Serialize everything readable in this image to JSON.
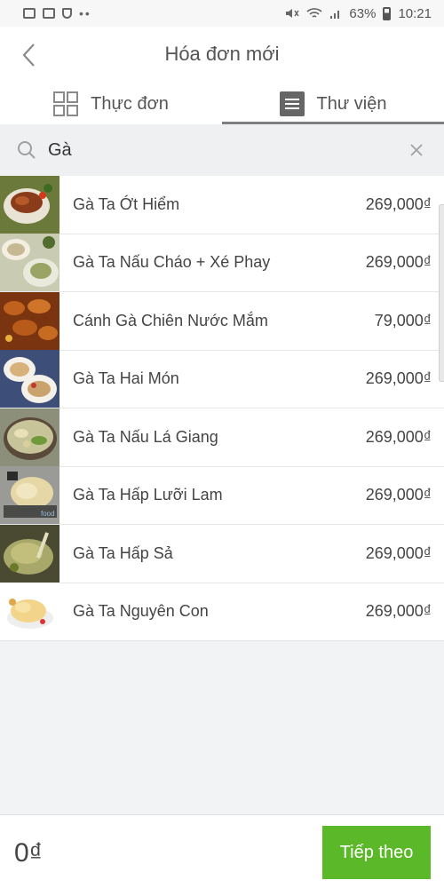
{
  "status_bar": {
    "battery": "63%",
    "time": "10:21"
  },
  "header": {
    "title": "Hóa đơn mới"
  },
  "tabs": [
    {
      "label": "Thực đơn",
      "icon": "grid-icon"
    },
    {
      "label": "Thư viện",
      "icon": "list-icon",
      "active": true
    }
  ],
  "search": {
    "value": "Gà"
  },
  "items": [
    {
      "name": "Gà Ta Ớt Hiểm",
      "price": "269,000₫"
    },
    {
      "name": "Gà Ta Nấu Cháo + Xé Phay",
      "price": "269,000₫"
    },
    {
      "name": "Cánh Gà Chiên Nước Mắm",
      "price": "79,000₫"
    },
    {
      "name": "Gà Ta Hai Món",
      "price": "269,000₫"
    },
    {
      "name": "Gà Ta Nấu Lá Giang",
      "price": "269,000₫"
    },
    {
      "name": "Gà Ta Hấp Lưỡi Lam",
      "price": "269,000₫"
    },
    {
      "name": "Gà Ta Hấp Sả",
      "price": "269,000₫"
    },
    {
      "name": "Gà Ta Nguyên Con",
      "price": "269,000₫"
    }
  ],
  "footer": {
    "total": "0₫",
    "next_label": "Tiếp theo"
  },
  "colors": {
    "accent": "#5bb829",
    "tab_underline": "#7f7f7f"
  }
}
